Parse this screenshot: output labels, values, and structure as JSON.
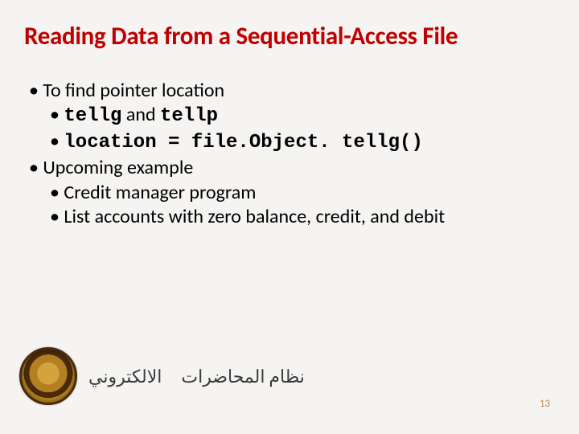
{
  "title": "Reading Data from a Sequential-Access File",
  "bullets": {
    "b1": "To find pointer location",
    "b1a_code1": "tellg",
    "b1a_mid": " and ",
    "b1a_code2": "tellp",
    "b1b_code": "location = file.Object. tellg()",
    "b2": "Upcoming example",
    "b2a": "Credit manager program",
    "b2b": "List accounts with zero balance, credit, and debit"
  },
  "footer": {
    "ar_right": "نظام المحاضرات",
    "ar_left": "الالكتروني"
  },
  "page": "13"
}
